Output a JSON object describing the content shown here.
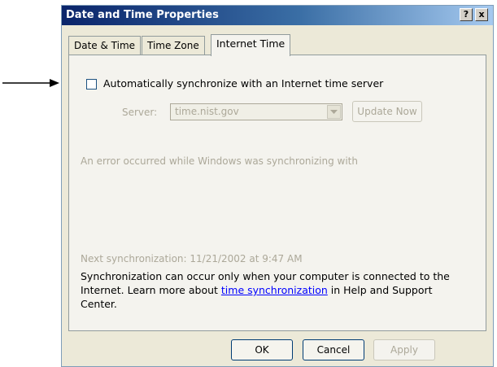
{
  "window": {
    "title": "Date and Time Properties",
    "help_label": "?",
    "close_label": "x"
  },
  "tabs": [
    {
      "label": "Date & Time"
    },
    {
      "label": "Time Zone"
    },
    {
      "label": "Internet Time"
    }
  ],
  "internet_time": {
    "sync_label": "Automatically synchronize with an Internet time server",
    "server_label": "Server:",
    "server_value": "time.nist.gov",
    "update_label": "Update Now",
    "status": "An error occurred while Windows was synchronizing with",
    "next_sync": "Next synchronization: 11/21/2002 at 9:47 AM",
    "help_prefix": "Synchronization can occur only when your computer is connected to the Internet.  Learn more about ",
    "help_link": "time synchronization",
    "help_suffix": " in Help and Support Center."
  },
  "buttons": {
    "ok": "OK",
    "cancel": "Cancel",
    "apply": "Apply"
  },
  "colors": {
    "title_bar": "#0a246a",
    "dialog_bg": "#ece9d8",
    "link": "#0000ff",
    "disabled_text": "#aca899"
  }
}
